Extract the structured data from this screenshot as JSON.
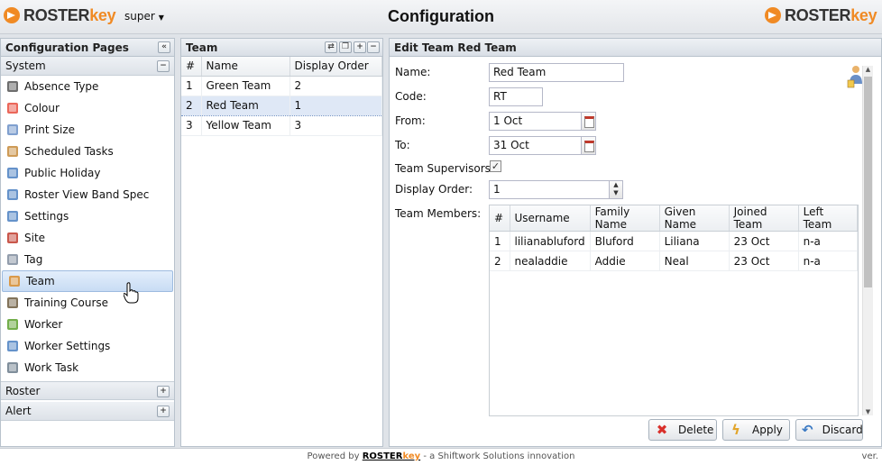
{
  "header": {
    "logo_left": {
      "r": "ROSTER",
      "k": "key"
    },
    "user": "super",
    "title": "Configuration",
    "logo_right": {
      "r": "ROSTER",
      "k": "key"
    }
  },
  "nav": {
    "title": "Configuration Pages",
    "group_system": "System",
    "items": [
      {
        "label": "Absence Type",
        "icon": "person-icon",
        "color": "#555555"
      },
      {
        "label": "Colour",
        "icon": "palette-icon",
        "color": "#e84c3d"
      },
      {
        "label": "Print Size",
        "icon": "page-icon",
        "color": "#6a8fc7"
      },
      {
        "label": "Scheduled Tasks",
        "icon": "clock-icon",
        "color": "#c58a3a"
      },
      {
        "label": "Public Holiday",
        "icon": "calendar-icon",
        "color": "#4a7fc1"
      },
      {
        "label": "Roster View Band Spec",
        "icon": "grid-icon",
        "color": "#4a7fc1"
      },
      {
        "label": "Settings",
        "icon": "gear-icon",
        "color": "#4a7fc1"
      },
      {
        "label": "Site",
        "icon": "factory-icon",
        "color": "#c0392b"
      },
      {
        "label": "Tag",
        "icon": "tag-icon",
        "color": "#7f8c9d"
      },
      {
        "label": "Team",
        "icon": "team-icon",
        "color": "#d98c2b"
      },
      {
        "label": "Training Course",
        "icon": "trainer-icon",
        "color": "#6c5b3d"
      },
      {
        "label": "Worker",
        "icon": "worker-icon",
        "color": "#5aa02c"
      },
      {
        "label": "Worker Settings",
        "icon": "worker-settings-icon",
        "color": "#4a7fc1"
      },
      {
        "label": "Work Task",
        "icon": "task-icon",
        "color": "#6a7a8a"
      }
    ],
    "group_roster": "Roster",
    "group_alert": "Alert"
  },
  "team_list": {
    "title": "Team",
    "columns": [
      "#",
      "Name",
      "Display Order"
    ],
    "rows": [
      {
        "num": "1",
        "name": "Green Team",
        "order": "2"
      },
      {
        "num": "2",
        "name": "Red Team",
        "order": "1"
      },
      {
        "num": "3",
        "name": "Yellow Team",
        "order": "3"
      }
    ]
  },
  "edit": {
    "title": "Edit Team Red Team",
    "labels": {
      "name": "Name:",
      "code": "Code:",
      "from": "From:",
      "to": "To:",
      "supervisors": "Team Supervisors:",
      "order": "Display Order:",
      "members": "Team Members:"
    },
    "values": {
      "name": "Red Team",
      "code": "RT",
      "from": "1 Oct",
      "to": "31 Oct",
      "order": "1"
    },
    "members_columns": [
      "#",
      "Username",
      "Family Name",
      "Given Name",
      "Joined Team",
      "Left Team"
    ],
    "members": [
      {
        "num": "1",
        "username": "lilianabluford",
        "family": "Bluford",
        "given": "Liliana",
        "joined": "23 Oct",
        "left": "n-a"
      },
      {
        "num": "2",
        "username": "nealaddie",
        "family": "Addie",
        "given": "Neal",
        "joined": "23 Oct",
        "left": "n-a"
      }
    ],
    "buttons": {
      "delete": "Delete",
      "apply": "Apply",
      "discard": "Discard"
    }
  },
  "footer": {
    "prefix": "Powered by",
    "brand_r": "ROSTER",
    "brand_k": "key",
    "suffix": "- a Shiftwork Solutions innovation",
    "ver": "ver."
  }
}
